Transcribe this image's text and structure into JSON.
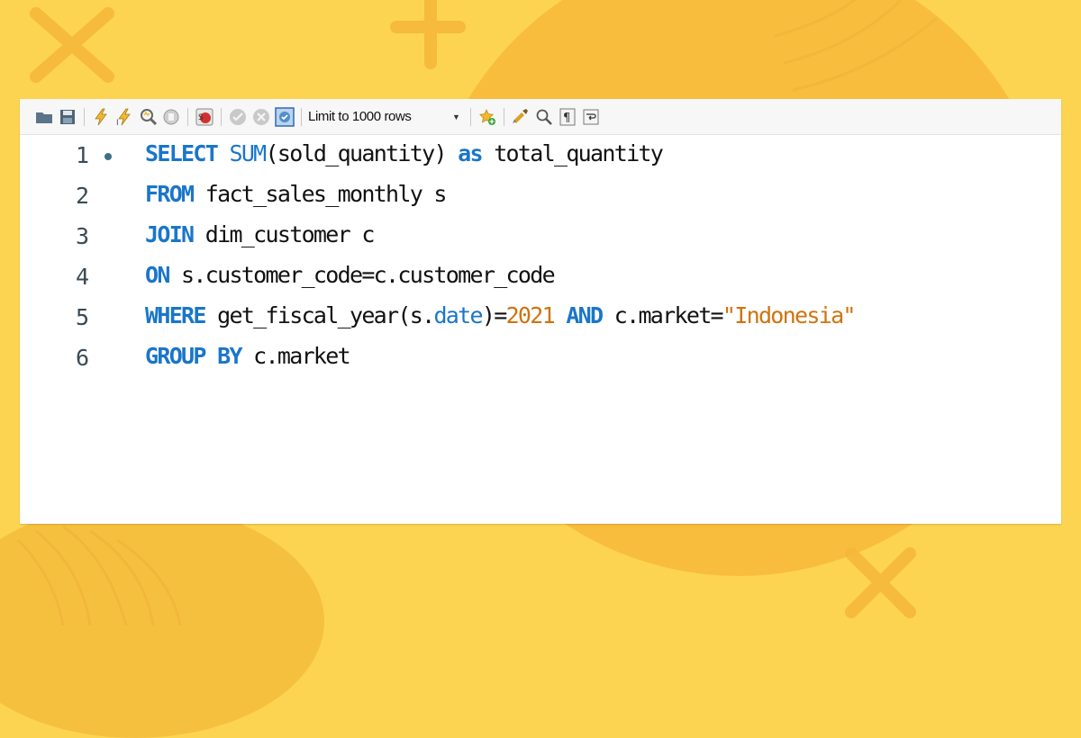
{
  "toolbar": {
    "icons": [
      "open-folder-icon",
      "save-icon",
      "execute-icon",
      "execute-current-icon",
      "explain-icon",
      "stop-icon",
      "toggle-error-icon",
      "commit-icon",
      "rollback-icon",
      "autocommit-icon",
      "add-snippet-icon",
      "beautify-icon",
      "find-icon",
      "invisible-chars-icon",
      "wrap-lines-icon"
    ],
    "limit_label": "Limit to 1000 rows"
  },
  "editor": {
    "lines": [
      {
        "number": "1",
        "has_marker": true,
        "tokens": [
          {
            "t": "SELECT",
            "c": "kw"
          },
          {
            "t": " "
          },
          {
            "t": "SUM",
            "c": "fn"
          },
          {
            "t": "(sold_quantity) "
          },
          {
            "t": "as",
            "c": "kw"
          },
          {
            "t": " total_quantity"
          }
        ]
      },
      {
        "number": "2",
        "has_marker": false,
        "tokens": [
          {
            "t": "FROM",
            "c": "kw"
          },
          {
            "t": " fact_sales_monthly s"
          }
        ]
      },
      {
        "number": "3",
        "has_marker": false,
        "tokens": [
          {
            "t": "JOIN",
            "c": "kw"
          },
          {
            "t": " dim_customer c"
          }
        ]
      },
      {
        "number": "4",
        "has_marker": false,
        "tokens": [
          {
            "t": "ON",
            "c": "kw"
          },
          {
            "t": " s.customer_code=c.customer_code"
          }
        ]
      },
      {
        "number": "5",
        "has_marker": false,
        "tokens": [
          {
            "t": "WHERE",
            "c": "kw"
          },
          {
            "t": " get_fiscal_year(s."
          },
          {
            "t": "date",
            "c": "prop"
          },
          {
            "t": ")="
          },
          {
            "t": "2021",
            "c": "num"
          },
          {
            "t": " "
          },
          {
            "t": "AND",
            "c": "kw"
          },
          {
            "t": " c.market="
          },
          {
            "t": "\"Indonesia\"",
            "c": "str"
          }
        ]
      },
      {
        "number": "6",
        "has_marker": false,
        "tokens": [
          {
            "t": "GROUP BY",
            "c": "kw"
          },
          {
            "t": " c.market"
          }
        ]
      }
    ]
  },
  "colors": {
    "background": "#fdd451",
    "keyword": "#1a76c9",
    "literal": "#d0730e"
  }
}
